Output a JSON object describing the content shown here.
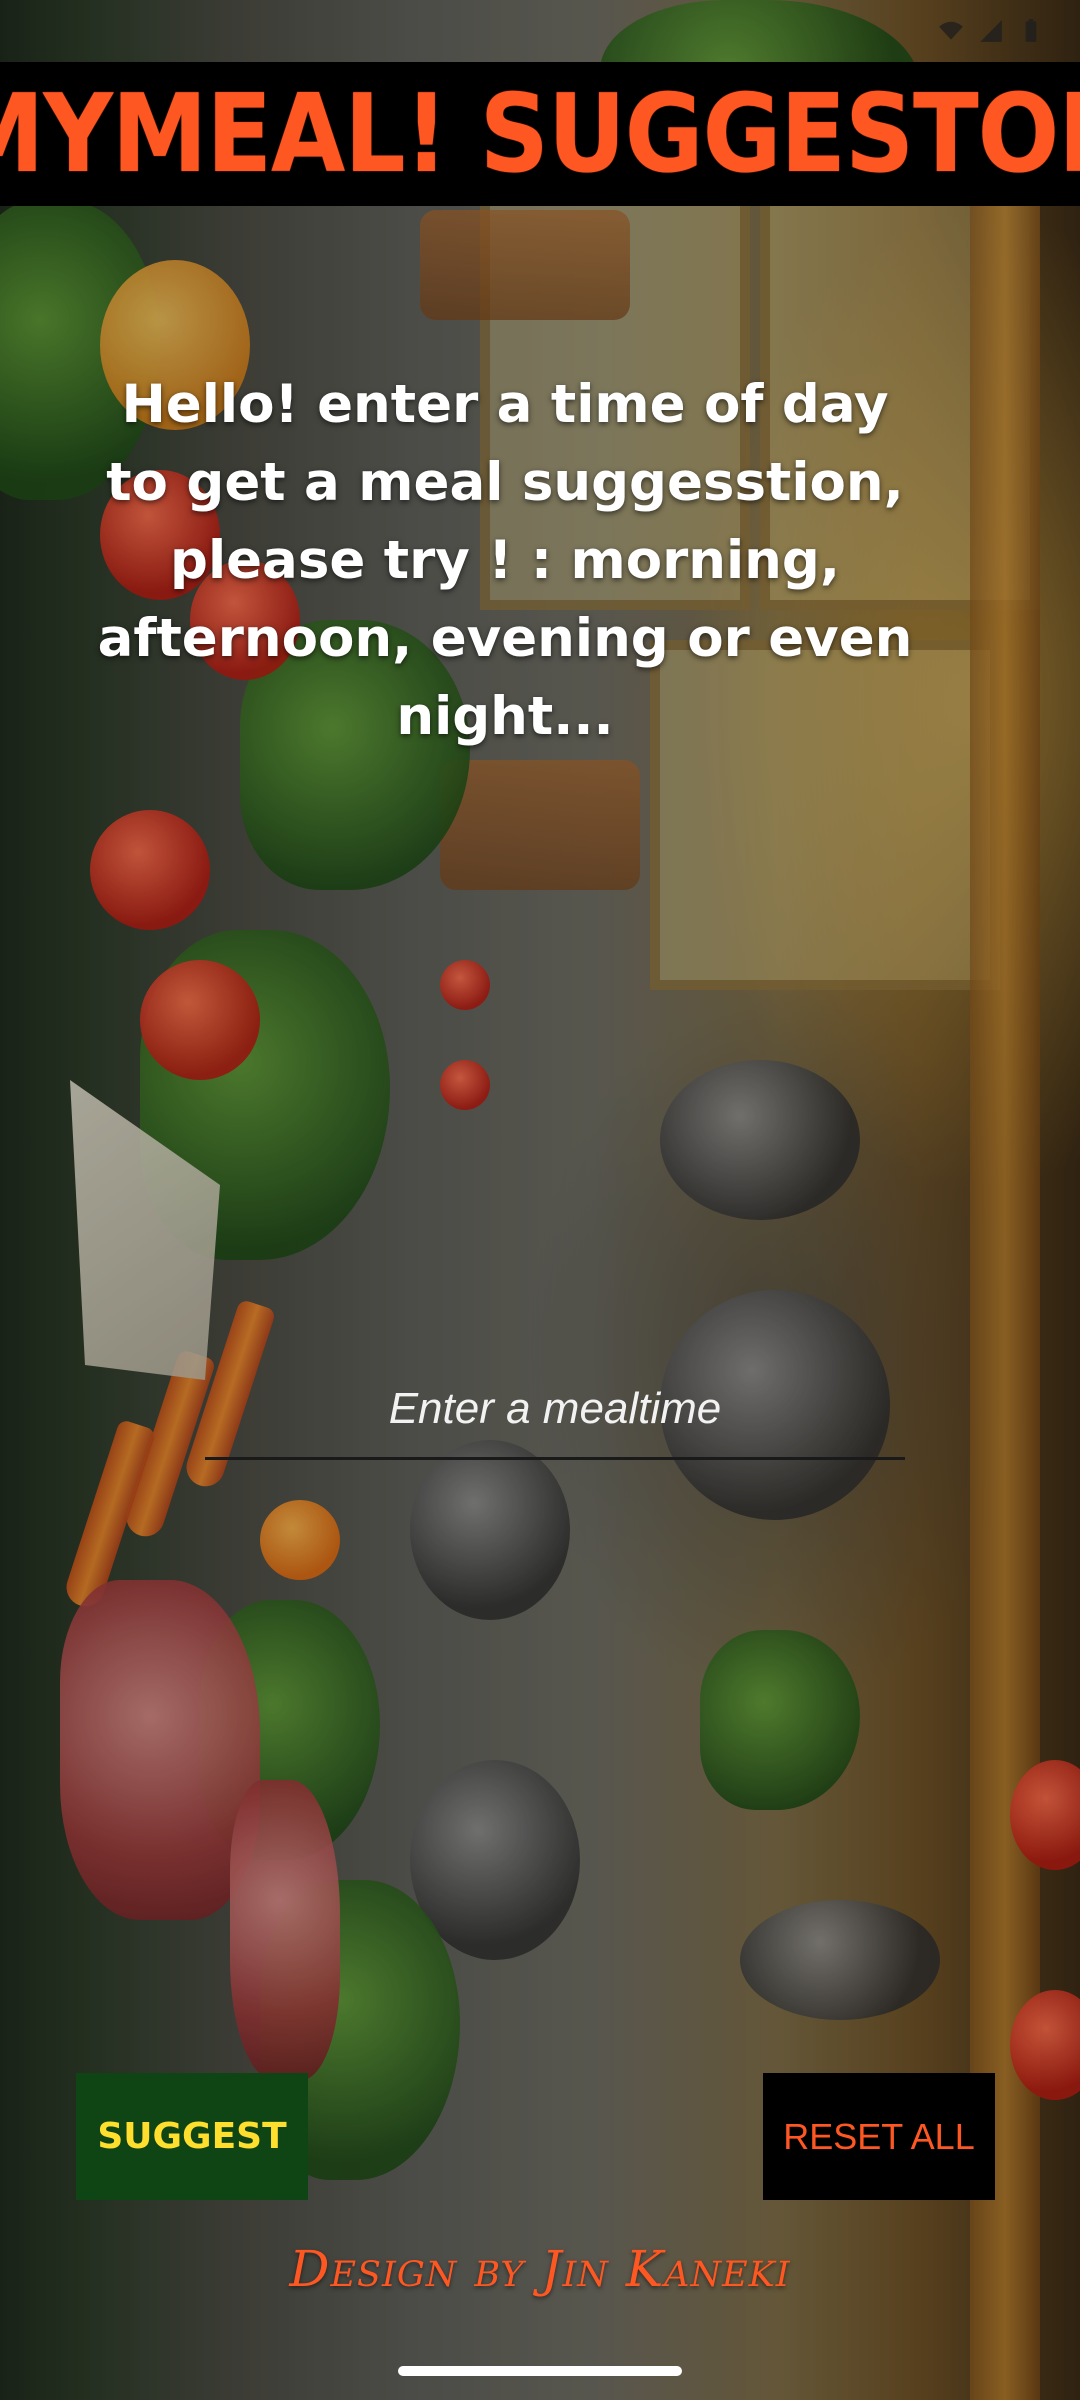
{
  "status_bar": {
    "time": "",
    "icons": [
      "wifi-icon",
      "signal-icon",
      "battery-icon"
    ]
  },
  "app": {
    "title": "MYMEAL! SUGGESTOR",
    "title_color": "#ff5722",
    "title_bar_color": "#000000"
  },
  "main": {
    "instructions": "Hello! enter a time of day to get a meal suggesstion, please try ! : morning, afternoon, evening or even night..."
  },
  "input": {
    "placeholder": "Enter a mealtime",
    "value": ""
  },
  "buttons": {
    "suggest_label": "SUGGEST",
    "suggest_bg": "#0f4514",
    "suggest_text_color": "#ffde2e",
    "reset_label": "RESET ALL",
    "reset_bg": "#000000",
    "reset_text_color": "#ff5722"
  },
  "footer": {
    "credit": "Design by Jin Kaneki"
  }
}
